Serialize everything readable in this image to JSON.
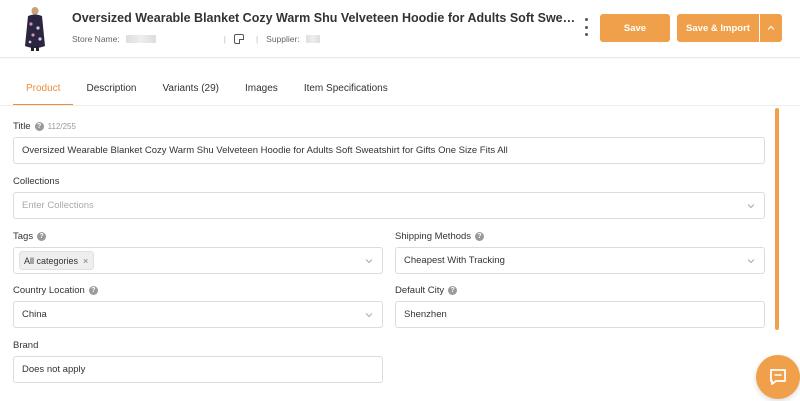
{
  "header": {
    "product_title": "Oversized Wearable Blanket Cozy Warm Shu Velveteen Hoodie for Adults Soft Sweatshirt for Gifts...",
    "store_label": "Store Name:",
    "supplier_label": "Supplier:",
    "save_label": "Save",
    "save_import_label": "Save & Import"
  },
  "tabs": [
    {
      "label": "Product",
      "active": true
    },
    {
      "label": "Description",
      "active": false
    },
    {
      "label": "Variants (29)",
      "active": false
    },
    {
      "label": "Images",
      "active": false
    },
    {
      "label": "Item Specifications",
      "active": false
    }
  ],
  "form": {
    "title": {
      "label": "Title",
      "count": "112/255",
      "value": "Oversized Wearable Blanket Cozy Warm Shu Velveteen Hoodie for Adults Soft Sweatshirt for Gifts One Size Fits All"
    },
    "collections": {
      "label": "Collections",
      "placeholder": "Enter Collections"
    },
    "tags": {
      "label": "Tags",
      "chip": "All categories"
    },
    "shipping_methods": {
      "label": "Shipping Methods",
      "value": "Cheapest With Tracking"
    },
    "country_location": {
      "label": "Country Location",
      "value": "China"
    },
    "default_city": {
      "label": "Default City",
      "value": "Shenzhen"
    },
    "brand": {
      "label": "Brand",
      "value": "Does not apply"
    }
  },
  "icons": {
    "help": "?",
    "chip_remove": "×"
  },
  "colors": {
    "accent": "#f0a04b",
    "tab_active": "#e8913a"
  }
}
